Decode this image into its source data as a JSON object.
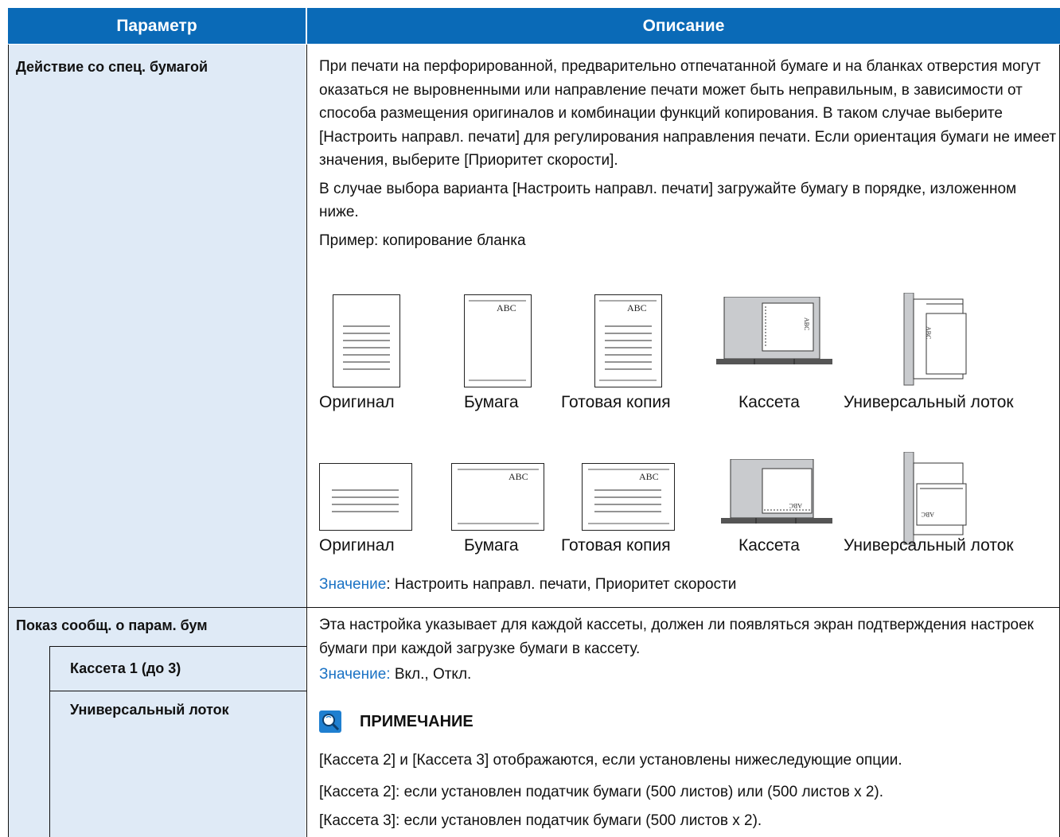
{
  "header": {
    "param": "Параметр",
    "desc": "Описание"
  },
  "row1": {
    "label": "Действие со спец. бумагой",
    "para1": "При печати на перфорированной, предварительно отпечатанной бумаге и на бланках отверстия могут оказаться не выровненными или направление печати может быть неправильным, в зависимости от способа размещения оригиналов и комбинации функций копирования. В таком случае выберите [Настроить направл. печати] для регулирования направления печати. Если ориентация бумаги не имеет значения, выберите [Приоритет скорости].",
    "para2": "В случае выбора варианта [Настроить направл. печати] загружайте бумагу в порядке, изложенном ниже.",
    "example": "Пример: копирование бланка",
    "captions": [
      "Оригинал",
      "Бумага",
      "Готовая копия",
      "Кассета",
      "Универсальный лоток"
    ],
    "paper_text": "ABC",
    "value_key": "Значение",
    "value_text": ": Настроить направл. печати, Приоритет скорости"
  },
  "row2": {
    "label": "Показ сообщ. о парам. бум",
    "sub1": "Кассета 1 (до 3)",
    "sub2": "Универсальный лоток",
    "para": "Эта настройка указывает для каждой кассеты, должен ли появляться экран подтверждения настроек бумаги при каждой загрузке бумаги в кассету.",
    "value_key": "Значение:",
    "value_text": " Вкл., Откл.",
    "note_title": "ПРИМЕЧАНИЕ",
    "note_icon": "magnifier-note-icon",
    "note_lines": [
      "[Кассета 2] и [Кассета 3] отображаются, если установлены нижеследующие опции.",
      "[Кассета 2]: если установлен податчик бумаги (500 листов) или (500 листов x 2).",
      "[Кассета 3]: если установлен податчик бумаги (500 листов x 2)."
    ]
  },
  "colors": {
    "header_bg": "#0a6ab7",
    "param_bg": "#dfeaf6",
    "value_key": "#1a72c4",
    "tray_grey": "#c9cbce"
  }
}
